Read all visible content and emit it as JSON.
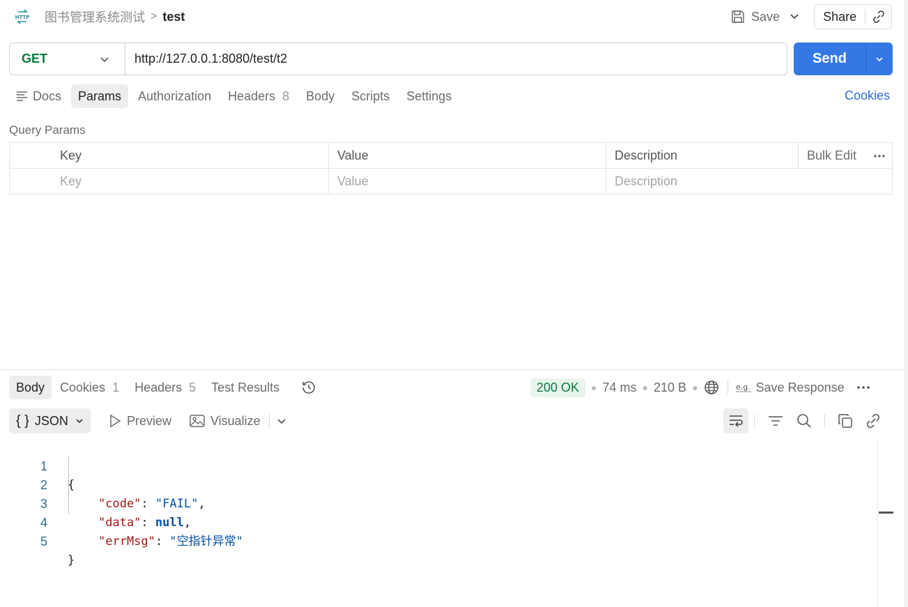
{
  "header": {
    "app_icon": "http-icon",
    "collection": "图书管理系统测试",
    "separator": ">",
    "request_name": "test",
    "save_label": "Save",
    "share_label": "Share"
  },
  "request": {
    "method": "GET",
    "url": "http://127.0.0.1:8080/test/t2",
    "send_label": "Send"
  },
  "request_tabs": [
    {
      "label": "Docs"
    },
    {
      "label": "Params",
      "active": true
    },
    {
      "label": "Authorization"
    },
    {
      "label": "Headers",
      "count": "8"
    },
    {
      "label": "Body"
    },
    {
      "label": "Scripts"
    },
    {
      "label": "Settings"
    }
  ],
  "cookies_link": "Cookies",
  "query_params": {
    "title": "Query Params",
    "headers": {
      "key": "Key",
      "value": "Value",
      "description": "Description",
      "bulk_edit": "Bulk Edit"
    },
    "placeholders": {
      "key": "Key",
      "value": "Value",
      "description": "Description"
    }
  },
  "response": {
    "tabs": [
      {
        "label": "Body",
        "active": true
      },
      {
        "label": "Cookies",
        "count": "1"
      },
      {
        "label": "Headers",
        "count": "5"
      },
      {
        "label": "Test Results"
      }
    ],
    "status": "200 OK",
    "time": "74 ms",
    "size": "210 B",
    "save_response": "Save Response",
    "format": "JSON",
    "preview_label": "Preview",
    "visualize_label": "Visualize",
    "body_lines": [
      {
        "num": "1",
        "text": "{"
      },
      {
        "num": "2",
        "key": "\"code\"",
        "value": "\"FAIL\"",
        "value_type": "string",
        "trail": ","
      },
      {
        "num": "3",
        "key": "\"data\"",
        "value": "null",
        "value_type": "null",
        "trail": ","
      },
      {
        "num": "4",
        "key": "\"errMsg\"",
        "value": "\"空指针异常\"",
        "value_type": "string",
        "trail": ""
      },
      {
        "num": "5",
        "text": "}"
      }
    ]
  },
  "colors": {
    "accent": "#3478e5",
    "method_get": "#0b7a3e",
    "status_ok": "#0b7a3e",
    "json_key": "#a31515",
    "json_value": "#0451a5",
    "link": "#2b6ad8"
  }
}
